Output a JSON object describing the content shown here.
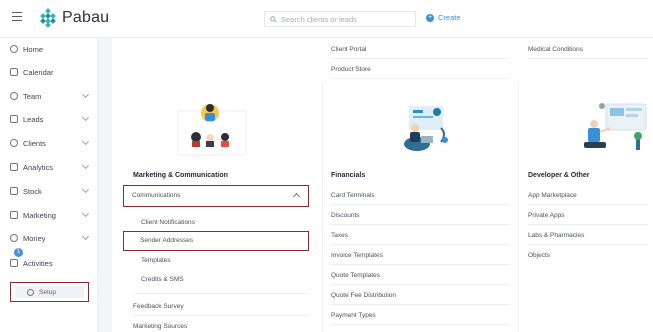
{
  "header": {
    "app_name": "Pabau",
    "search_placeholder": "Search clients or leads",
    "create_label": "Create"
  },
  "sidebar": {
    "items": [
      {
        "label": "Home"
      },
      {
        "label": "Calendar"
      },
      {
        "label": "Team"
      },
      {
        "label": "Leads"
      },
      {
        "label": "Clients"
      },
      {
        "label": "Analytics"
      },
      {
        "label": "Stock"
      },
      {
        "label": "Marketing"
      },
      {
        "label": "Money"
      },
      {
        "label": "Activities",
        "badge": "1"
      },
      {
        "label": "Setup"
      }
    ]
  },
  "columns": {
    "marketing": {
      "heading": "Marketing & Communication",
      "communications_label": "Communications",
      "sub_items": [
        "Client Notifications",
        "Sender Addresses",
        "Templates",
        "Credits & SMS"
      ],
      "more_items": [
        "Feedback Survey",
        "Marketing Sources"
      ]
    },
    "financials": {
      "top_items": [
        "Client Portal",
        "Product Store"
      ],
      "heading": "Financials",
      "items": [
        "Card Terminals",
        "Discounts",
        "Taxes",
        "Invoice Templates",
        "Quote Templates",
        "Quote Fee Distribution",
        "Payment Types"
      ]
    },
    "developer": {
      "top_items": [
        "Medical Conditions"
      ],
      "heading": "Developer & Other",
      "items": [
        "App Marketplace",
        "Private Apps",
        "Labs & Pharmacies",
        "Objects"
      ]
    }
  },
  "colors": {
    "accent": "#3a8fd9",
    "highlight_border": "#8b2a2a",
    "logo_teal": "#2bb3c0"
  }
}
